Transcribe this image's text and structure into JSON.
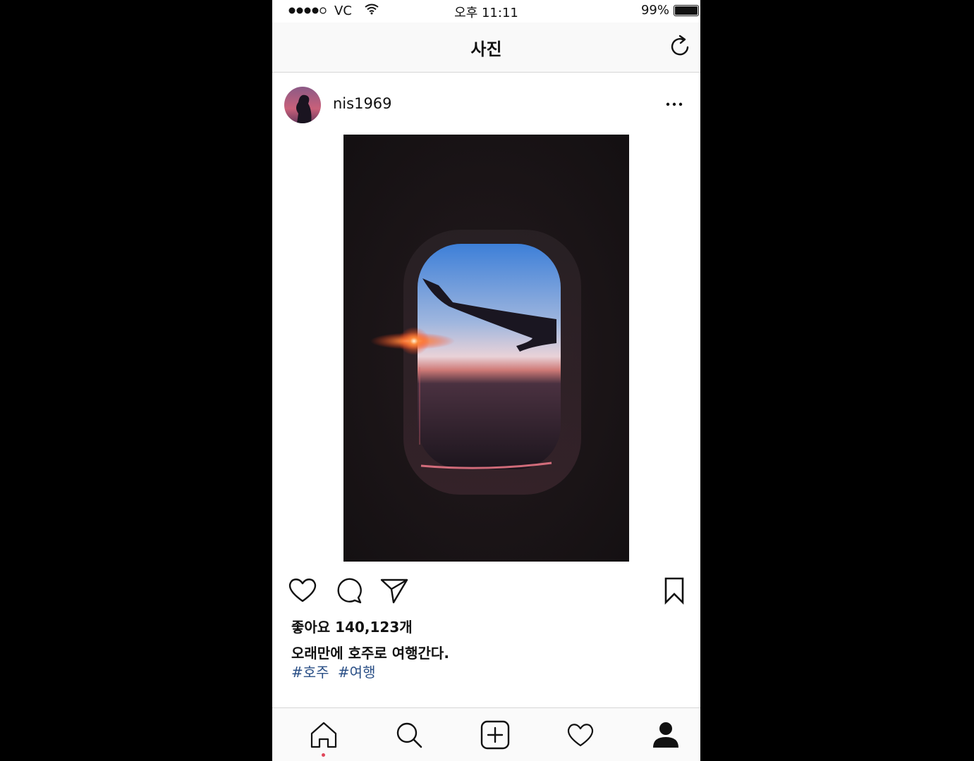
{
  "status_bar": {
    "carrier": "VC",
    "time": "오후 11:11",
    "battery": "99%",
    "battery_level": 0.99
  },
  "nav": {
    "title": "사진"
  },
  "post": {
    "username": "nis1969",
    "likes": "좋아요 140,123개",
    "caption": "오래만에 호주로 여행간다.",
    "hashtags": [
      "#호주",
      "#여행"
    ]
  },
  "icons": {
    "refresh": "refresh-icon",
    "more": "more-icon",
    "like": "heart-icon",
    "comment": "comment-icon",
    "share": "send-icon",
    "save": "bookmark-icon",
    "home": "home-icon",
    "search": "search-icon",
    "add": "add-icon",
    "activity": "heart-icon",
    "profile": "profile-icon"
  },
  "colors": {
    "hashtag": "#2a4f86",
    "active_dot": "#e0475a"
  }
}
